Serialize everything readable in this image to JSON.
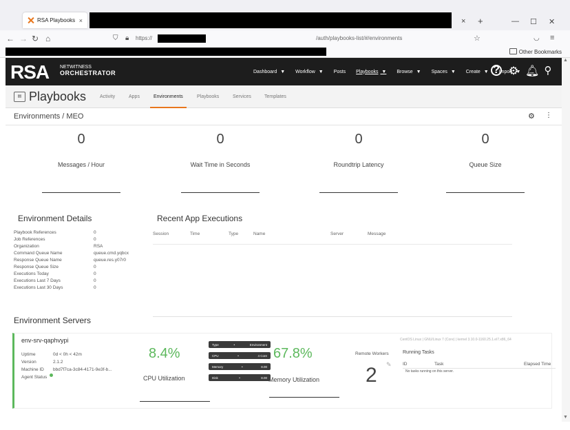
{
  "browser": {
    "tab_title": "RSA Playbooks",
    "tab_close": "×",
    "new_tab": "+",
    "url_prefix": "https://",
    "url_path": "/auth/playbooks-list/#/environments",
    "other_bookmarks": "Other Bookmarks",
    "minimize": "—",
    "maximize": "☐",
    "close": "✕"
  },
  "header": {
    "logo": "RSA",
    "logo_line1": "NETWITNESS",
    "logo_line2": "ORCHESTRATOR",
    "menu": [
      {
        "label": "Dashboard",
        "caret": true
      },
      {
        "label": "Workflow",
        "caret": true
      },
      {
        "label": "Posts",
        "caret": false
      },
      {
        "label": "Playbooks",
        "caret": true
      },
      {
        "label": "Browse",
        "caret": true
      },
      {
        "label": "Spaces",
        "caret": true
      },
      {
        "label": "Create",
        "caret": true
      },
      {
        "label": "Import",
        "caret": true
      }
    ]
  },
  "subnav": {
    "title": "Playbooks",
    "tabs": [
      "Activity",
      "Apps",
      "Environments",
      "Playbooks",
      "Services",
      "Templates"
    ],
    "active": "Environments"
  },
  "breadcrumb": "Environments / MEO",
  "metrics": [
    {
      "value": "0",
      "label": "Messages / Hour"
    },
    {
      "value": "0",
      "label": "Wait Time in Seconds"
    },
    {
      "value": "0",
      "label": "Roundtrip Latency"
    },
    {
      "value": "0",
      "label": "Queue Size"
    }
  ],
  "details": {
    "heading": "Environment Details",
    "rows": [
      {
        "k": "Playbook References",
        "v": "0"
      },
      {
        "k": "Job References",
        "v": "0"
      },
      {
        "k": "Organization",
        "v": "RSA"
      },
      {
        "k": "Command Queue Name",
        "v": "queue.cmd.yqbcx"
      },
      {
        "k": "Response Queue Name",
        "v": "queue.res.y07r0"
      },
      {
        "k": "Response Queue Size",
        "v": "0"
      },
      {
        "k": "Executions Today",
        "v": "0"
      },
      {
        "k": "Executions Last 7 Days",
        "v": "0"
      },
      {
        "k": "Executions Last 30 Days",
        "v": "0"
      }
    ]
  },
  "executions": {
    "heading": "Recent App Executions",
    "columns": [
      "Session",
      "Time",
      "Type",
      "Name",
      "Server",
      "Message"
    ]
  },
  "servers": {
    "heading": "Environment Servers",
    "name": "env-srv-qaphvypi",
    "info": [
      {
        "k": "Uptime",
        "v": "0d < 0h < 42m"
      },
      {
        "k": "Version",
        "v": "2.1.2"
      },
      {
        "k": "Machine ID",
        "v": "bbd7f7ca-3c84-4171-9e3f-b..."
      },
      {
        "k": "Agent Status",
        "v": ""
      }
    ],
    "cpu_pct": "8.4%",
    "cpu_label": "CPU Utilization",
    "mem_pct": "67.8%",
    "mem_label": "Memory Utilization",
    "badges": [
      {
        "k": "Type",
        "v": "Environment"
      },
      {
        "k": "CPU",
        "v": "4 Core"
      },
      {
        "k": "Memory",
        "v": "8.00"
      },
      {
        "k": "Disk",
        "v": "8.00"
      }
    ],
    "remote_workers_label": "Remote Workers",
    "remote_workers": "2",
    "os_info": "CentOS Linux | GNU/Linux 7 (Core) | kernel 3.10.0-1160.25.1.el7.x86_64",
    "running_tasks_label": "Running Tasks",
    "rt_columns": [
      "ID",
      "Task",
      "Elapsed Time"
    ],
    "rt_empty": "No tasks running on this server."
  }
}
